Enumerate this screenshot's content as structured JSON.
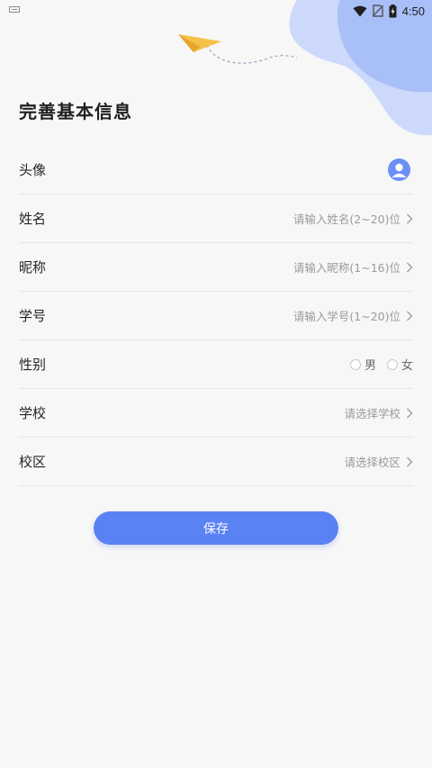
{
  "status_bar": {
    "time": "4:50"
  },
  "page_title": "完善基本信息",
  "fields": [
    {
      "label": "头像",
      "icon": "avatar-icon"
    },
    {
      "label": "姓名",
      "placeholder": "请输入姓名(2~20)位"
    },
    {
      "label": "昵称",
      "placeholder": "请输入昵称(1~16)位"
    },
    {
      "label": "学号",
      "placeholder": "请输入学号(1~20)位"
    },
    {
      "label": "性别",
      "options": [
        "男",
        "女"
      ]
    },
    {
      "label": "学校",
      "placeholder": "请选择学校"
    },
    {
      "label": "校区",
      "placeholder": "请选择校区"
    }
  ],
  "save_label": "保存",
  "colors": {
    "accent": "#5b82f5",
    "blob_light": "#cdd9fb",
    "blob_dark": "#a9bff7",
    "plane": "#f7c04a"
  }
}
